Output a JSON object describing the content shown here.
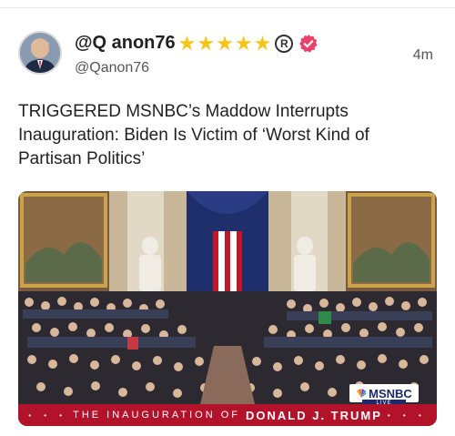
{
  "post": {
    "display_name": "@Q anon76",
    "stars": [
      "★",
      "★",
      "★",
      "★",
      "★"
    ],
    "registered_mark": "R",
    "handle": "@Qanon76",
    "timestamp": "4m",
    "headline": "TRIGGERED MSNBC’s Maddow Interrupts Inauguration: Biden Is Victim of ‘Worst Kind of Partisan Politics’"
  },
  "media": {
    "network_logo_text": "MSNBC",
    "live_label": "LIVE",
    "banner_dots_left": "• • •",
    "banner_text": "THE INAUGURATION OF",
    "banner_name": "DONALD J. TRUMP",
    "banner_dots_right": "• • •"
  },
  "colors": {
    "star": "#f5c518",
    "verified_badge": "#e8416b",
    "banner": "#b3122b",
    "msnbc_blue": "#1a2a6c"
  },
  "icons": {
    "verified": "verified-badge-icon",
    "registered": "registered-icon",
    "star": "star-icon",
    "network": "peacock-icon"
  }
}
